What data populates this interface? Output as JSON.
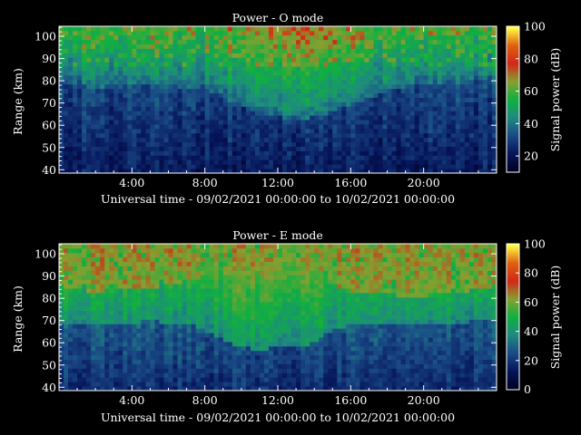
{
  "chart_data": [
    {
      "type": "heatmap",
      "title": "Power - O mode",
      "xlabel": "Universal time - 09/02/2021 00:00:00 to 10/02/2021 00:00:00",
      "ylabel": "Range (km)",
      "colorbar_label": "Signal power (dB)",
      "xlim": [
        0,
        24
      ],
      "ylim": [
        38.5,
        104.5
      ],
      "x_ticks": [
        4,
        8,
        12,
        16,
        20
      ],
      "x_tick_labels": [
        "4:00",
        "8:00",
        "12:00",
        "16:00",
        "20:00"
      ],
      "y_ticks": [
        40,
        50,
        60,
        70,
        80,
        90,
        100
      ],
      "y_tick_labels": [
        "40",
        "50",
        "60",
        "70",
        "80",
        "90",
        "100"
      ],
      "clim": [
        10,
        100
      ],
      "colorbar_ticks": [
        20,
        40,
        60,
        80,
        100
      ],
      "colorbar_tick_labels": [
        "20",
        "40",
        "60",
        "80",
        "100"
      ],
      "colormap": [
        "#000020",
        "#06155a",
        "#1a4a86",
        "#1f8a80",
        "#10b040",
        "#86a030",
        "#d02818",
        "#e06010",
        "#ffff40"
      ],
      "x_hours": [
        0,
        1,
        2,
        3,
        4,
        5,
        6,
        7,
        8,
        9,
        10,
        11,
        12,
        13,
        14,
        15,
        16,
        17,
        18,
        19,
        20,
        21,
        22,
        23,
        24
      ],
      "boundary_km": [
        82,
        80,
        79,
        79,
        80,
        80,
        79,
        79,
        79,
        74,
        70,
        68,
        66,
        64,
        66,
        68,
        71,
        74,
        77,
        79,
        80,
        80,
        81,
        82,
        82
      ],
      "lower_db": 22,
      "upper_db": 45,
      "top_db": 58
    },
    {
      "type": "heatmap",
      "title": "Power - E mode",
      "xlabel": "Universal time - 09/02/2021 00:00:00 to 10/02/2021 00:00:00",
      "ylabel": "Range (km)",
      "colorbar_label": "Signal power (dB)",
      "xlim": [
        0,
        24
      ],
      "ylim": [
        38.5,
        104.5
      ],
      "x_ticks": [
        4,
        8,
        12,
        16,
        20
      ],
      "x_tick_labels": [
        "4:00",
        "8:00",
        "12:00",
        "16:00",
        "20:00"
      ],
      "y_ticks": [
        40,
        50,
        60,
        70,
        80,
        90,
        100
      ],
      "y_tick_labels": [
        "40",
        "50",
        "60",
        "70",
        "80",
        "90",
        "100"
      ],
      "clim": [
        0,
        100
      ],
      "colorbar_ticks": [
        0,
        20,
        40,
        60,
        80,
        100
      ],
      "colorbar_tick_labels": [
        "0",
        "20",
        "40",
        "60",
        "80",
        "100"
      ],
      "colormap": [
        "#000020",
        "#06155a",
        "#1a4a86",
        "#1f8a80",
        "#10b040",
        "#86a030",
        "#d02818",
        "#e06010",
        "#ffff40"
      ],
      "x_hours": [
        0,
        1,
        2,
        3,
        4,
        5,
        6,
        7,
        8,
        9,
        10,
        11,
        12,
        13,
        14,
        15,
        16,
        17,
        18,
        19,
        20,
        21,
        22,
        23,
        24
      ],
      "red_bottom_km": [
        84,
        84,
        83,
        84,
        85,
        85,
        86,
        87,
        90,
        95,
        98,
        99,
        99,
        98,
        97,
        86,
        83,
        82,
        82,
        81,
        81,
        82,
        83,
        84,
        84
      ],
      "green_bottom_km": [
        72,
        72,
        72,
        72,
        73,
        74,
        73,
        73,
        70,
        65,
        62,
        61,
        62,
        62,
        64,
        70,
        72,
        73,
        72,
        72,
        72,
        72,
        73,
        74,
        74
      ],
      "lower_db": 18,
      "mid_db": 45,
      "red_db": 62
    }
  ]
}
